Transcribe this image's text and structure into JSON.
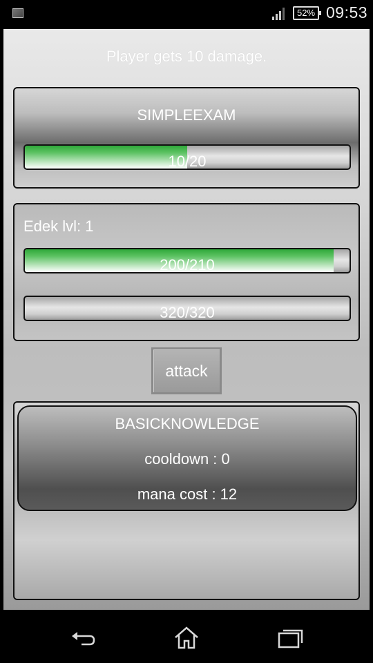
{
  "status_bar": {
    "battery": "52%",
    "time": "09:53"
  },
  "message": "Player gets 10 damage.",
  "enemy": {
    "name": "SIMPLEEXAM",
    "hp_text": "10/20",
    "hp_fraction": 0.5,
    "hp_color": "#3fb24a"
  },
  "player": {
    "name_label": "Edek lvl: 1",
    "hp_text": "200/210",
    "hp_fraction": 0.952,
    "mana_text": "320/320",
    "mana_fraction": 1.0
  },
  "attack_button": {
    "label": "attack"
  },
  "skills": [
    {
      "name": "BASICKNOWLEDGE",
      "cooldown": "cooldown : 0",
      "mana_cost": "mana cost : 12"
    }
  ],
  "nav": {
    "icons": [
      "back-icon",
      "home-icon",
      "recent-apps-icon"
    ]
  }
}
